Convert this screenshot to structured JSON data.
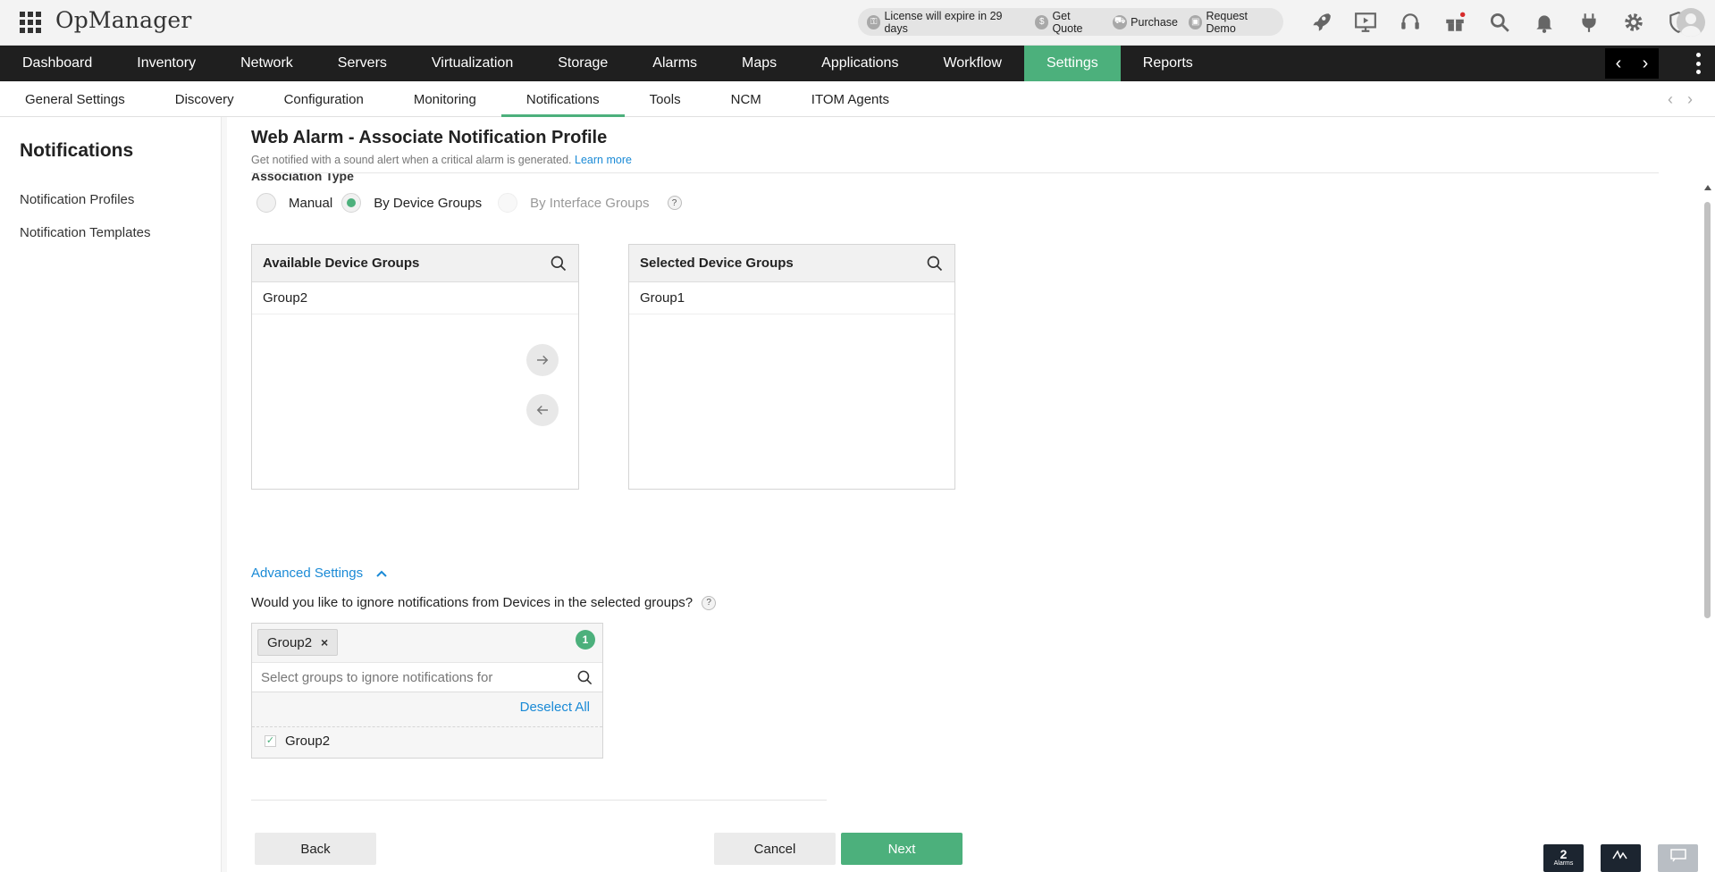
{
  "app": {
    "brand": "OpManager",
    "license_text": "License will expire in 29 days",
    "get_quote": "Get Quote",
    "purchase": "Purchase",
    "request_demo": "Request Demo"
  },
  "main_nav": {
    "items": [
      "Dashboard",
      "Inventory",
      "Network",
      "Servers",
      "Virtualization",
      "Storage",
      "Alarms",
      "Maps",
      "Applications",
      "Workflow",
      "Settings",
      "Reports"
    ],
    "active": "Settings"
  },
  "sub_nav": {
    "items": [
      "General Settings",
      "Discovery",
      "Configuration",
      "Monitoring",
      "Notifications",
      "Tools",
      "NCM",
      "ITOM Agents"
    ],
    "active": "Notifications"
  },
  "sidebar": {
    "title": "Notifications",
    "links": [
      "Notification Profiles",
      "Notification Templates"
    ]
  },
  "page": {
    "title": "Web Alarm - Associate Notification Profile",
    "subtitle": "Get notified with a sound alert when a critical alarm is generated.",
    "learn_more": "Learn more",
    "association_label": "Association Type",
    "radio_manual": "Manual",
    "radio_device_groups": "By Device Groups",
    "radio_interface_groups": "By Interface Groups",
    "selected_radio": "By Device Groups"
  },
  "available": {
    "header": "Available Device Groups",
    "items": [
      "Group2"
    ]
  },
  "selected": {
    "header": "Selected Device Groups",
    "items": [
      "Group1"
    ]
  },
  "advanced": {
    "link": "Advanced Settings",
    "question": "Would you like to ignore notifications from Devices in the selected groups?",
    "chip": "Group2",
    "count": "1",
    "search_placeholder": "Select groups to ignore notifications for",
    "deselect_all": "Deselect All",
    "option": "Group2",
    "option_checked": true
  },
  "buttons": {
    "back": "Back",
    "cancel": "Cancel",
    "next": "Next"
  },
  "widgets": {
    "alarms_count": "2",
    "alarms_label": "Alarms"
  },
  "colors": {
    "accent": "#4cb07c",
    "link": "#1a8ad6",
    "nav_bg": "#1f1f1f"
  }
}
